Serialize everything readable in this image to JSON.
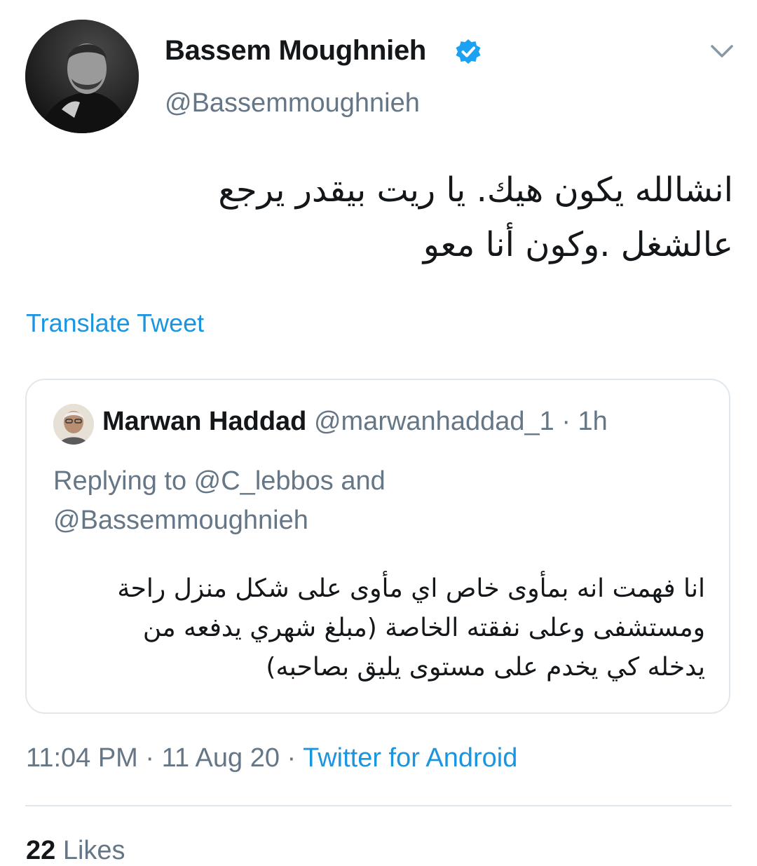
{
  "tweet": {
    "author": {
      "display_name": "Bassem Moughnieh",
      "handle": "@Bassemmoughnieh",
      "verified": true
    },
    "text_line_1": "انشالله يكون هيك. يا ريت بيقدر يرجع",
    "text_line_2": "عالشغل .وكون أنا معو",
    "translate_label": "Translate Tweet",
    "quoted": {
      "author_name": "Marwan Haddad",
      "author_handle": "@marwanhaddad_1",
      "separator": "·",
      "time": "1h",
      "reply_line_1": "Replying to @C_lebbos and",
      "reply_line_2": "@Bassemmoughnieh",
      "text_line_1": "انا فهمت انه بمأوى خاص اي مأوى على شكل منزل راحة",
      "text_line_2": "ومستشفى وعلى نفقته الخاصة (مبلغ شهري يدفعه من",
      "text_line_3": "يدخله كي يخدم على مستوى يليق بصاحبه)"
    },
    "meta": {
      "time": "11:04 PM",
      "separator": "·",
      "date": "11 Aug 20",
      "source": "Twitter for Android"
    },
    "likes": {
      "count": "22",
      "label": "Likes"
    }
  },
  "colors": {
    "link": "#1b95e0",
    "muted": "#657786",
    "text": "#14171a",
    "border": "#e1e8ed"
  },
  "icons": {
    "verified": "verified-badge-icon",
    "menu": "chevron-down-icon"
  }
}
